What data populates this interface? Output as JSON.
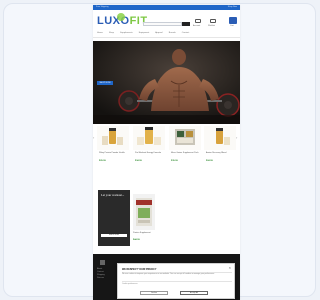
{
  "topbar": {
    "left_text": "Free Shipping",
    "right_text": "Shop Now"
  },
  "header": {
    "logo_main": "LUXO",
    "logo_accent": "FIT",
    "search_placeholder": "Search products...",
    "search_button": "SEARCH",
    "account_label": "Account",
    "wishlist_label": "Wishlist",
    "cart_label": "Cart"
  },
  "nav": {
    "items": [
      "Home",
      "Shop",
      "Supplements",
      "Equipment",
      "Apparel",
      "Brands",
      "Contact"
    ]
  },
  "hero": {
    "cta": "SHOP NOW"
  },
  "products": [
    {
      "name": "Whey Protein Powder Vanilla",
      "price": "$29.99"
    },
    {
      "name": "Pre-Workout Energy Formula",
      "price": "$34.99"
    },
    {
      "name": "Mass Gainer Supplement Pack",
      "price": "$39.99"
    },
    {
      "name": "Amino Recovery Blend",
      "price": "$24.99"
    }
  ],
  "promo": {
    "title": "Let your workout...",
    "button": "SHOP NOW"
  },
  "featured": {
    "name": "Protein Supplement",
    "price": "$44.99"
  },
  "footer": {
    "col1": [
      "About",
      "Contact",
      "Shipping",
      "Returns"
    ]
  },
  "modal": {
    "title": "WE RESPECT YOUR PRIVACY",
    "text": "We use cookies to improve your experience on our website. You can accept all cookies or manage your preferences.",
    "label": "Cookie preferences",
    "decline": "Decline",
    "accept": "Accept All"
  },
  "colors": {
    "brand_blue": "#1f66c8",
    "brand_green": "#7dc843",
    "price_green": "#2f8a2f"
  }
}
